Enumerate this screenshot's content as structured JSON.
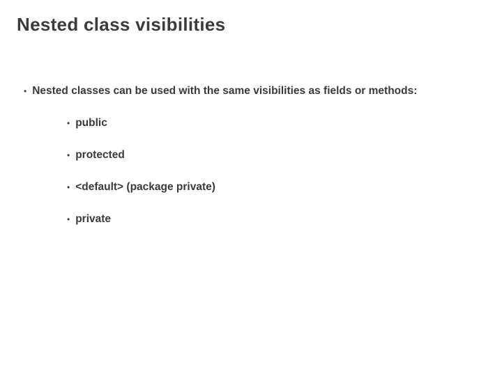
{
  "slide": {
    "title": "Nested class visibilities",
    "bullets": {
      "main": "Nested classes can be used with the same visibilities as fields or methods:",
      "sub": [
        "public",
        "protected",
        "<default> (package private)",
        "private"
      ]
    }
  }
}
